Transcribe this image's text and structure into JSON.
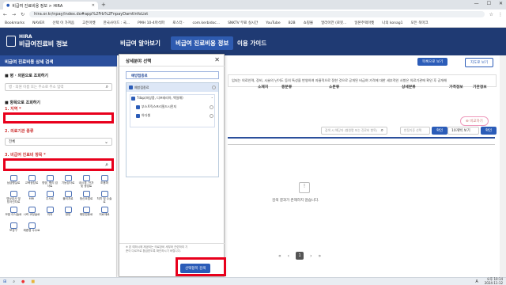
{
  "browser": {
    "tab_title": "비급여 진료비용 정보 > HIRA",
    "url": "hira.or.kr/npay/index.do#app%2Frb%2FnpayDamtInfoList",
    "bookmarks": [
      "Bookmarks",
      "NAVER",
      "선택 이 가져옴",
      "고든마켓",
      "한국사이드 : 국...",
      "PMH 10-4마석파",
      "로스터 ·",
      "com.kerbidoc...",
      "SNKTV 무료 실시간",
      "YouTube",
      "B2B",
      "쇼핑몰",
      "얼라이언 (로봇...",
      "일본주택마켓",
      "나의 konag1",
      "모든 북마크"
    ]
  },
  "site": {
    "logo_top": "HIRA",
    "logo_bottom": "비급여진료비 정보",
    "nav": [
      "비급여 알아보기",
      "비급여 진료비용 정보",
      "이용 가이드"
    ]
  },
  "left_panel": {
    "title": "비급여 진료비용 상세 검색",
    "hospital_search": "병 · 의원으로 조회하기",
    "hospital_placeholder": "병 · 의원 이름 또는 주소로 주소 입력",
    "item_search": "항목으로 조회하기",
    "region_label": "1. 지역 *",
    "type_label": "2. 의료기관 종류",
    "type_value": "전체",
    "item_label": "3. 비급여 진료비 항목 *",
    "categories": [
      "상급병실료",
      "교육상담료",
      "영양, 병리 검사료",
      "기능검사료",
      "내시경, 천자 및 생검료",
      "초음파",
      "영상검사 및 방사선치료",
      "MRI",
      "주사료",
      "물리치료",
      "정신요법료",
      "처치 및 수술료",
      "모발 이식술료",
      "시력 교정술료",
      "치과",
      "한방",
      "예방접종료",
      "치료재료",
      "보장구",
      "제증명 수수료"
    ]
  },
  "main": {
    "btn_map": "목록으로 보기",
    "btn_list": "지도로 보기",
    "description": "입되는 의료인력, 장비, 시술의 난이도 등의 특성을 반영하여 자율적으로 정한 것으로 공개된 비급여 가격에 대한 세부적인 사항은 의료기관에 확인 후 공개해",
    "search_placeholder": "검색 시 해당자 (병원명 또는 진료비 항목)",
    "sort_placeholder": "반정기준 선택",
    "confirm": "확인",
    "per_page": "10개씩 보기",
    "confirm2": "확인",
    "compare_btn": "비교하기",
    "columns": [
      "소재지",
      "중분류",
      "소분류",
      "상세분류",
      "가격정보",
      "기관정보"
    ],
    "empty_message": "검색 결과가 존재하지 않습니다.",
    "pages": [
      "«",
      "‹",
      "1",
      "›",
      "»"
    ]
  },
  "modal": {
    "title": "상세분야 선택",
    "tab": "예방접종료",
    "tree": [
      {
        "label": "예방접종료",
        "level": 0
      },
      {
        "label": "Tdap(파상풍, 디프테리아, 백일해)",
        "level": 1
      },
      {
        "label": "부스트릭스프리필드시린지",
        "level": 2
      },
      {
        "label": "아다셀",
        "level": 2
      }
    ],
    "note": "※ 본 예하시에 제공되는 의료장비 세부와 관련하여 기준이 다르므로 환급받도록 확인하시기 바랍니다.",
    "submit": "선택항목 검색"
  },
  "taskbar": {
    "time": "오후 10:14",
    "date": "2024-11-12",
    "lang": "A"
  },
  "colors": {
    "header": "#1f3a73",
    "accent": "#2b5cb8",
    "highlight": "#e8001c"
  }
}
